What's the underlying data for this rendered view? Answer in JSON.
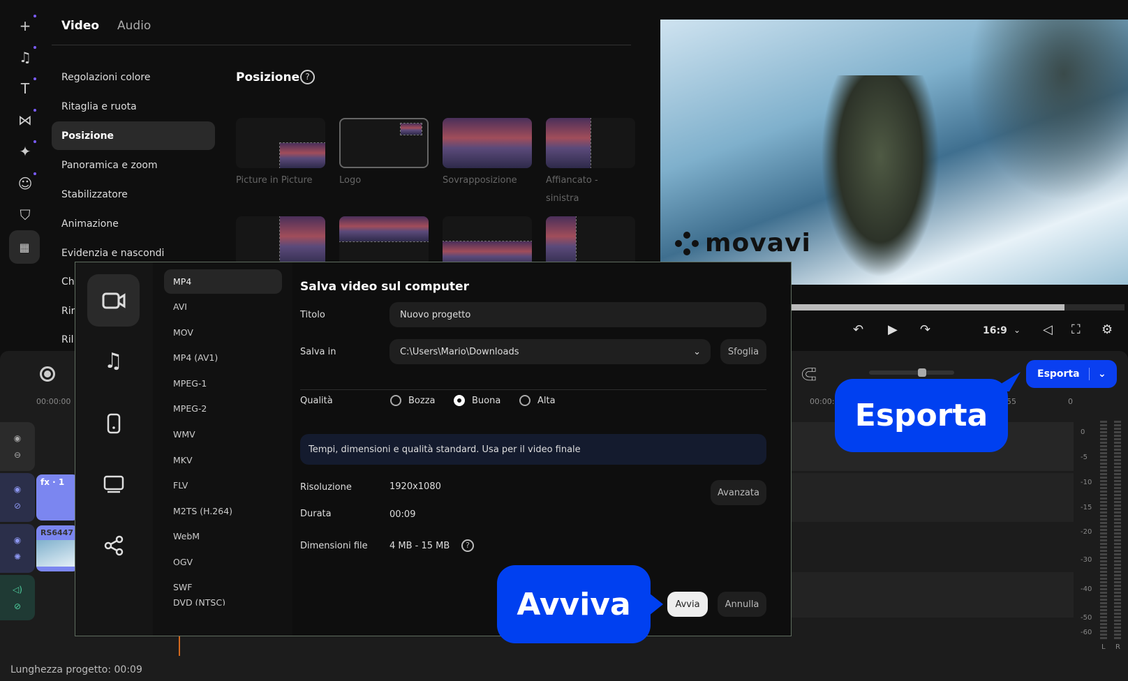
{
  "sidebar_rail": {
    "icons": [
      "add-icon",
      "music-icon",
      "text-icon",
      "transition-icon",
      "effects-icon",
      "sticker-icon",
      "store-icon",
      "more-tools-icon"
    ]
  },
  "tabs": {
    "video": "Video",
    "audio": "Audio"
  },
  "menu": [
    "Regolazioni colore",
    "Ritaglia e ruota",
    "Posizione",
    "Panoramica e zoom",
    "Stabilizzatore",
    "Animazione",
    "Evidenzia e nascondi",
    "Ch",
    "Rin",
    "Ril"
  ],
  "position_panel": {
    "title": "Posizione",
    "presets": [
      "Picture in Picture",
      "Logo",
      "Sovrapposizione",
      "Affiancato - sinistra"
    ]
  },
  "preview": {
    "watermark": "movavi",
    "progress": 0.82
  },
  "player": {
    "aspect": "16:9"
  },
  "timeline": {
    "start_time": "00:00:00",
    "ruler_right": [
      "00:00:",
      "55",
      "0"
    ],
    "clips": {
      "fx": "fx · 1",
      "video": "RS6447"
    },
    "vu_labels": [
      "0",
      "-5",
      "-10",
      "-15",
      "-20",
      "-30",
      "-40",
      "-50",
      "-60"
    ],
    "vu_channels": [
      "L",
      "R"
    ],
    "project_length": "Lunghezza progetto: 00:09"
  },
  "export_button": "Esporta",
  "dialog": {
    "formats": [
      "MP4",
      "AVI",
      "MOV",
      "MP4 (AV1)",
      "MPEG-1",
      "MPEG-2",
      "WMV",
      "MKV",
      "FLV",
      "M2TS (H.264)",
      "WebM",
      "OGV",
      "SWF",
      "DVD (NTSC)"
    ],
    "title": "Salva video sul computer",
    "title_label": "Titolo",
    "title_value": "Nuovo progetto",
    "save_label": "Salva in",
    "save_value": "C:\\Users\\Mario\\Downloads",
    "browse": "Sfoglia",
    "quality_label": "Qualità",
    "quality_options": [
      "Bozza",
      "Buona",
      "Alta"
    ],
    "quality_selected": "Buona",
    "quality_info": "Tempi, dimensioni e qualità standard. Usa per il video finale",
    "resolution_label": "Risoluzione",
    "resolution": "1920x1080",
    "advanced": "Avanzata",
    "duration_label": "Durata",
    "duration": "00:09",
    "size_label": "Dimensioni file",
    "size": "4 MB - 15 MB",
    "start": "Avvia",
    "cancel": "Annulla"
  },
  "callouts": {
    "export": "Esporta",
    "start": "Avviva"
  },
  "colors": {
    "accent": "#0040f0",
    "video_track": "#7b86f0",
    "audio_track": "#1f3a34"
  }
}
